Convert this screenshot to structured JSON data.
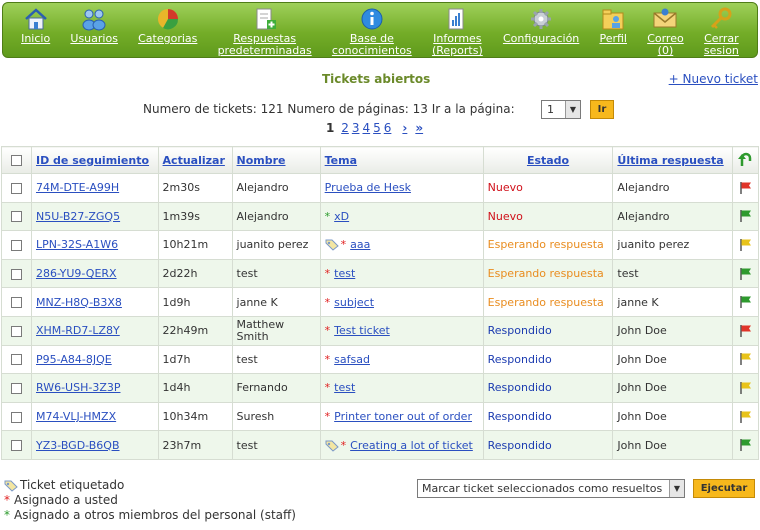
{
  "nav": {
    "items": [
      {
        "label": "Inicio",
        "icon": "home-icon"
      },
      {
        "label": "Usuarios",
        "icon": "users-icon"
      },
      {
        "label": "Categorias",
        "icon": "pie-chart-icon"
      },
      {
        "label": "Respuestas\npredeterminadas",
        "icon": "canned-responses-icon"
      },
      {
        "label": "Base de\nconocimientos",
        "icon": "info-icon"
      },
      {
        "label": "Informes\n(Reports)",
        "icon": "reports-icon"
      },
      {
        "label": "Configuración",
        "icon": "gear-icon"
      },
      {
        "label": "Perfil",
        "icon": "profile-icon"
      },
      {
        "label": "Correo\n(0)",
        "icon": "mail-icon"
      },
      {
        "label": "Cerrar\nsesion",
        "icon": "key-icon"
      }
    ]
  },
  "header": {
    "title": "Tickets abiertos",
    "new_ticket": "+ Nuevo ticket"
  },
  "pagination": {
    "info": "Numero de tickets: 121 Numero de páginas: 13 Ir a la página:",
    "selected_page": "1",
    "go_label": "Ir",
    "current": "1",
    "pages": [
      "2",
      "3",
      "4",
      "5",
      "6"
    ],
    "next": "›",
    "last": "»"
  },
  "table": {
    "columns": {
      "id": "ID de seguimiento",
      "updated": "Actualizar",
      "name": "Nombre",
      "subject": "Tema",
      "status": "Estado",
      "last_reply": "Última respuesta"
    },
    "rows": [
      {
        "id": "74M-DTE-A99H",
        "updated": "2m30s",
        "name": "Alejandro",
        "tag": false,
        "mark": "",
        "subject": "Prueba de Hesk",
        "status": "Nuevo",
        "status_type": "new",
        "last_reply": "Alejandro",
        "flag": "red"
      },
      {
        "id": "N5U-B27-ZGQ5",
        "updated": "1m39s",
        "name": "Alejandro",
        "tag": false,
        "mark": "green",
        "subject": "xD",
        "status": "Nuevo",
        "status_type": "new",
        "last_reply": "Alejandro",
        "flag": "green"
      },
      {
        "id": "LPN-32S-A1W6",
        "updated": "10h21m",
        "name": "juanito perez",
        "tag": true,
        "mark": "red",
        "subject": "aaa",
        "status": "Esperando respuesta",
        "status_type": "wait",
        "last_reply": "juanito perez",
        "flag": "yellow"
      },
      {
        "id": "286-YU9-QERX",
        "updated": "2d22h",
        "name": "test",
        "tag": false,
        "mark": "red",
        "subject": "test",
        "status": "Esperando respuesta",
        "status_type": "wait",
        "last_reply": "test",
        "flag": "green"
      },
      {
        "id": "MNZ-H8Q-B3X8",
        "updated": "1d9h",
        "name": "janne K",
        "tag": false,
        "mark": "red",
        "subject": "subject",
        "status": "Esperando respuesta",
        "status_type": "wait",
        "last_reply": "janne K",
        "flag": "green"
      },
      {
        "id": "XHM-RD7-LZ8Y",
        "updated": "22h49m",
        "name": "Matthew Smith",
        "tag": false,
        "mark": "red",
        "subject": "Test ticket",
        "status": "Respondido",
        "status_type": "resp",
        "last_reply": "John Doe",
        "flag": "red"
      },
      {
        "id": "P95-A84-8JQE",
        "updated": "1d7h",
        "name": "test",
        "tag": false,
        "mark": "red",
        "subject": "safsad",
        "status": "Respondido",
        "status_type": "resp",
        "last_reply": "John Doe",
        "flag": "yellow"
      },
      {
        "id": "RW6-USH-3Z3P",
        "updated": "1d4h",
        "name": "Fernando",
        "tag": false,
        "mark": "red",
        "subject": "test",
        "status": "Respondido",
        "status_type": "resp",
        "last_reply": "John Doe",
        "flag": "yellow"
      },
      {
        "id": "M74-VLJ-HMZX",
        "updated": "10h34m",
        "name": "Suresh",
        "tag": false,
        "mark": "red",
        "subject": "Printer toner out of order",
        "status": "Respondido",
        "status_type": "resp",
        "last_reply": "John Doe",
        "flag": "yellow"
      },
      {
        "id": "YZ3-BGD-B6QB",
        "updated": "23h7m",
        "name": "test",
        "tag": true,
        "mark": "red",
        "subject": "Creating a lot of ticket",
        "status": "Respondido",
        "status_type": "resp",
        "last_reply": "John Doe",
        "flag": "green"
      }
    ]
  },
  "legend": {
    "tagged": "Ticket etiquetado",
    "assigned_you": "Asignado a usted",
    "assigned_others": "Asignado a otros miembros del personal (staff)"
  },
  "actions": {
    "bulk_value": "Marcar ticket seleccionados como resueltos",
    "execute": "Ejecutar"
  },
  "colors": {
    "nav_bg": "#74ad28",
    "link": "#2a4fc0",
    "status_new": "#d0101a",
    "status_wait": "#e98d20",
    "status_resp": "#1c3cb0",
    "row_alt": "#eef7eb",
    "button": "#f7b81c"
  }
}
